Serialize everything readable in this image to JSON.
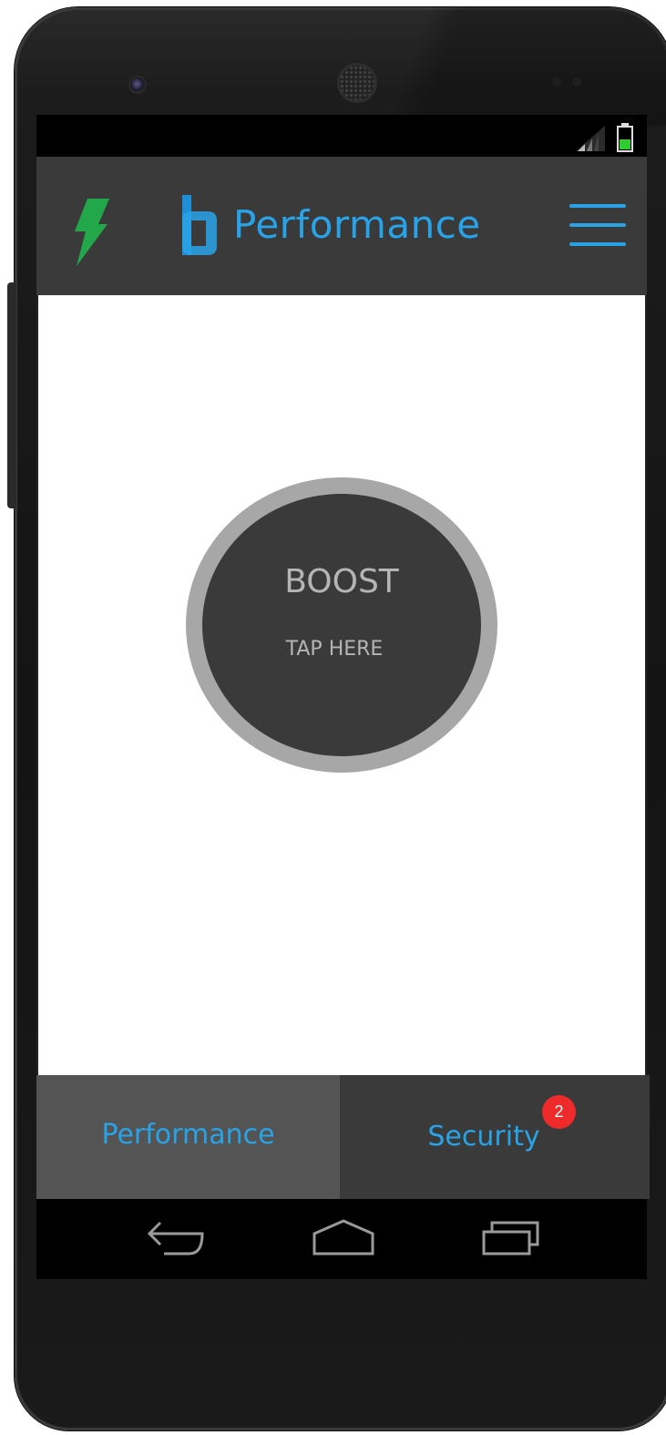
{
  "status_bar": {
    "signal_icon": "cell-signal-icon",
    "battery_icon": "battery-icon",
    "battery_color": "#2ecc2e"
  },
  "app_bar": {
    "left_icon": "lightning-bolt-icon",
    "logo_icon": "app-logo-icon",
    "title": "Performance",
    "menu_icon": "hamburger-menu-icon",
    "accent_color": "#29a3e8",
    "bolt_color": "#22a84a"
  },
  "boost": {
    "label": "BOOST",
    "subtitle": "TAP HERE"
  },
  "tabs": [
    {
      "label": "Performance",
      "active": true
    },
    {
      "label": "Security",
      "badge": "2"
    }
  ],
  "nav_bar": {
    "back_icon": "back-icon",
    "home_icon": "home-icon",
    "recents_icon": "recents-icon"
  }
}
